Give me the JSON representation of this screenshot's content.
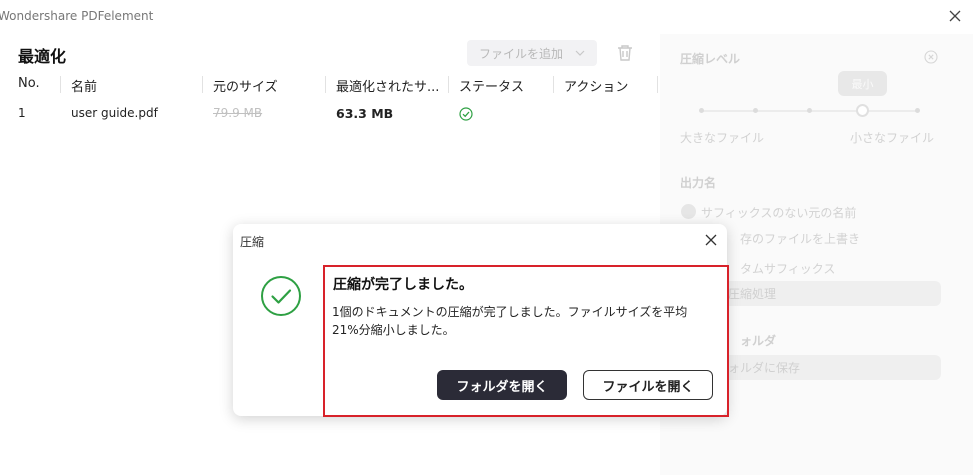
{
  "app": {
    "title": "Wondershare PDFelement"
  },
  "main": {
    "title": "最適化",
    "add_file_label": "ファイルを追加",
    "columns": [
      "No.",
      "名前",
      "元のサイズ",
      "最適化されたサ...",
      "ステータス",
      "アクション"
    ],
    "rows": [
      {
        "no": "1",
        "name": "user guide.pdf",
        "original_size": "79.9 MB",
        "optimized_size": "63.3 MB",
        "status": "completed"
      }
    ]
  },
  "sidepanel": {
    "compression_level_label": "圧縮レベル",
    "slider_tooltip": "最小",
    "slider_min_label": "大きなファイル",
    "slider_max_label": "小さなファイル",
    "output_name_label": "出力名",
    "options": [
      "サフィックスのない元の名前",
      "存のファイルを上書き",
      "タムサフィックス"
    ],
    "suffix_value": "圧縮処理",
    "folder_label": "ォルダ",
    "folder_select": "ォルダに保存"
  },
  "dialog": {
    "title": "圧縮",
    "message_title": "圧縮が完了しました。",
    "message_body": "1個のドキュメントの圧縮が完了しました。ファイルサイズを平均21%分縮小しました。",
    "open_folder_label": "フォルダを開く",
    "open_file_label": "ファイルを開く"
  },
  "icons": {
    "window_close": "close-icon",
    "trash": "trash-icon",
    "status": "check-circle-icon",
    "success": "check-circle-icon",
    "dialog_close": "close-icon"
  },
  "colors": {
    "primary_button": "#2b2b37",
    "success": "#2ea043",
    "highlight": "#d8222a"
  }
}
